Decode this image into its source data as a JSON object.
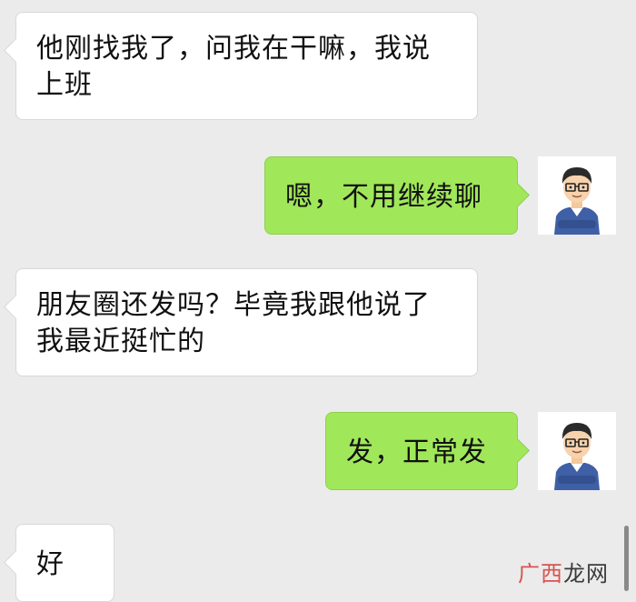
{
  "messages": [
    {
      "side": "left",
      "text": "他刚找我了，问我在干嘛，我说上班"
    },
    {
      "side": "right",
      "text": "嗯，不用继续聊"
    },
    {
      "side": "left",
      "text": "朋友圈还发吗？毕竟我跟他说了我最近挺忙的"
    },
    {
      "side": "right",
      "text": "发，正常发"
    },
    {
      "side": "left",
      "text": "好"
    }
  ],
  "watermark": {
    "part1": "广西",
    "part2": "龙网"
  },
  "colors": {
    "background": "#ebebeb",
    "sent_bubble": "#a0e75a",
    "received_bubble": "#ffffff"
  },
  "icons": {
    "avatar": "cartoon-man-with-glasses-avatar"
  }
}
